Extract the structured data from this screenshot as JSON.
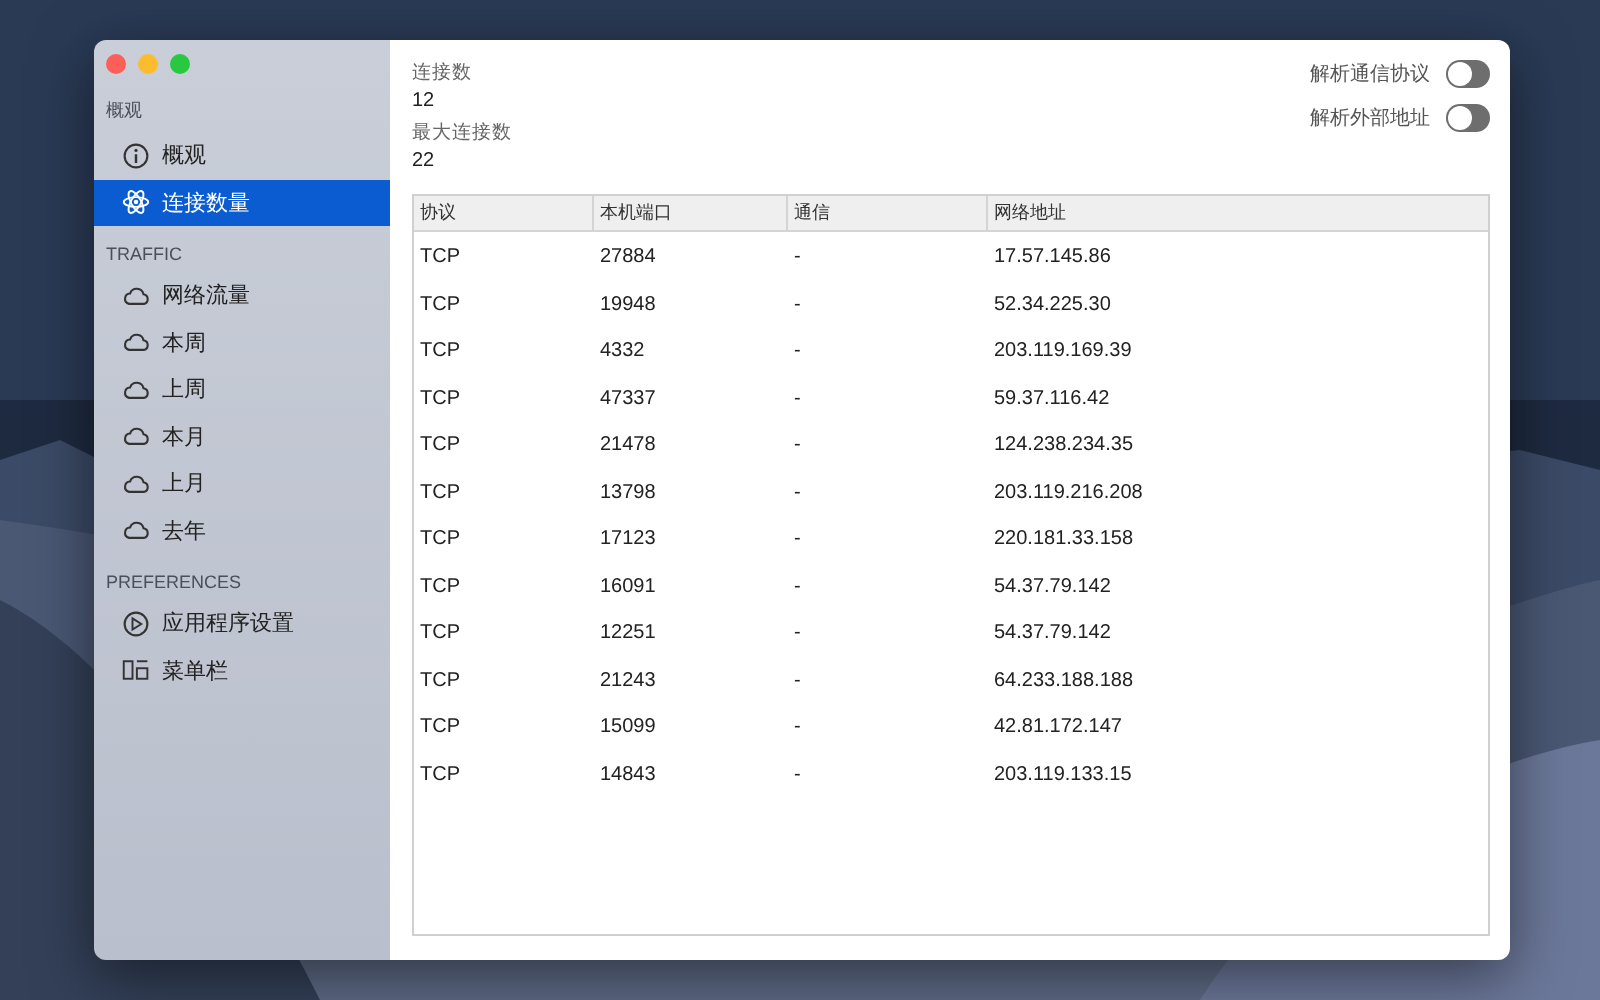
{
  "sidebar": {
    "groups": [
      {
        "title": "概观",
        "items": [
          {
            "label": "概观",
            "selected": false
          },
          {
            "label": "连接数量",
            "selected": true
          }
        ]
      },
      {
        "title": "TRAFFIC",
        "items": [
          {
            "label": "网络流量",
            "selected": false
          },
          {
            "label": "本周",
            "selected": false
          },
          {
            "label": "上周",
            "selected": false
          },
          {
            "label": "本月",
            "selected": false
          },
          {
            "label": "上月",
            "selected": false
          },
          {
            "label": "去年",
            "selected": false
          }
        ]
      },
      {
        "title": "PREFERENCES",
        "items": [
          {
            "label": "应用程序设置",
            "selected": false
          },
          {
            "label": "菜单栏",
            "selected": false
          }
        ]
      }
    ]
  },
  "stats": [
    {
      "label": "连接数",
      "value": "12"
    },
    {
      "label": "最大连接数",
      "value": "22"
    }
  ],
  "toggles": [
    {
      "label": "解析通信协议",
      "on": false
    },
    {
      "label": "解析外部地址",
      "on": false
    }
  ],
  "table": {
    "columns": [
      "协议",
      "本机端口",
      "通信",
      "网络地址"
    ],
    "rows": [
      [
        "TCP",
        "27884",
        "-",
        "17.57.145.86"
      ],
      [
        "TCP",
        "19948",
        "-",
        "52.34.225.30"
      ],
      [
        "TCP",
        "4332",
        "-",
        "203.119.169.39"
      ],
      [
        "TCP",
        "47337",
        "-",
        "59.37.116.42"
      ],
      [
        "TCP",
        "21478",
        "-",
        "124.238.234.35"
      ],
      [
        "TCP",
        "13798",
        "-",
        "203.119.216.208"
      ],
      [
        "TCP",
        "17123",
        "-",
        "220.181.33.158"
      ],
      [
        "TCP",
        "16091",
        "-",
        "54.37.79.142"
      ],
      [
        "TCP",
        "12251",
        "-",
        "54.37.79.142"
      ],
      [
        "TCP",
        "21243",
        "-",
        "64.233.188.188"
      ],
      [
        "TCP",
        "15099",
        "-",
        "42.81.172.147"
      ],
      [
        "TCP",
        "14843",
        "-",
        "203.119.133.15"
      ]
    ]
  }
}
